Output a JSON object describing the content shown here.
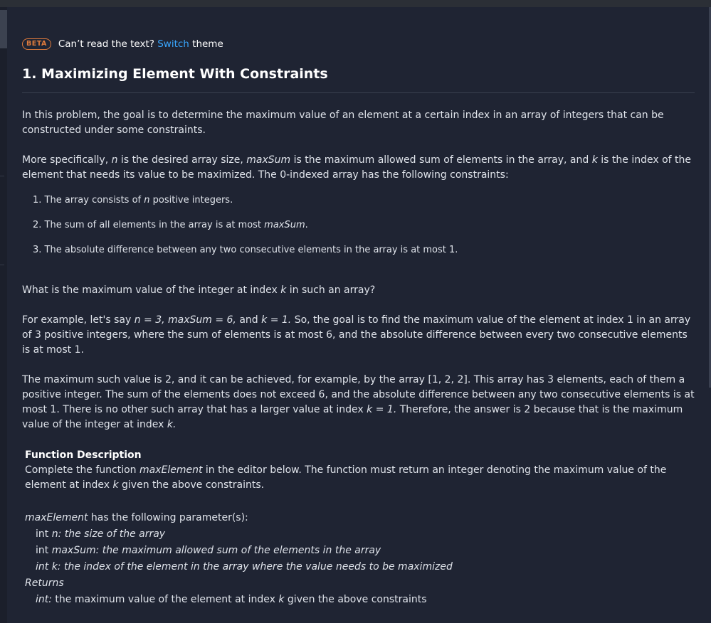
{
  "banner": {
    "badge": "BETA",
    "prefix": "Can’t read the text?",
    "link": "Switch",
    "suffix": "theme"
  },
  "problem": {
    "title": "1. Maximizing Element With Constraints",
    "intro": "In this problem, the goal is to determine the maximum value of an element at a certain index in an array of integers that can be constructed under some constraints.",
    "spec": {
      "t1": "More specifically, ",
      "n": "n",
      "t2": " is the desired array size, ",
      "maxSum": "maxSum",
      "t3": " is the maximum allowed sum of elements in the array, and ",
      "k": "k",
      "t4": " is the index of the element that needs its value to be maximized. The 0-indexed array has the following constraints:"
    },
    "constraints": [
      {
        "num": "1.",
        "pre": "The array consists of ",
        "em": "n",
        "post": " positive integers."
      },
      {
        "num": "2.",
        "pre": "The sum of all elements in the array is at most ",
        "em": "maxSum",
        "post": "."
      },
      {
        "num": "3.",
        "pre": "The absolute difference between any two consecutive elements in the array is at most 1.",
        "em": "",
        "post": ""
      }
    ],
    "question": {
      "pre": "What is the maximum value of the integer at index ",
      "k": "k",
      "post": " in such an array?"
    },
    "example": {
      "t1": "For example, let's say ",
      "e1": "n = 3, maxSum = 6,",
      "t2": " and ",
      "e2": "k = 1.",
      "t3": " So, the goal is to find the maximum value of the element at index 1 in an array of 3 positive integers, where the sum of elements is at most 6, and the absolute difference between every two consecutive elements is at most 1."
    },
    "explanation": {
      "t1": "The maximum such value is 2, and it can be achieved, for example, by the array [1, 2, 2]. This array has 3 elements, each of them a positive integer. The sum of the elements does not exceed 6, and the absolute difference between any two consecutive elements is at most 1. There is no other such array that has a larger value at index ",
      "e1": "k = 1.",
      "t2": " Therefore, the answer is 2 because that is the maximum value of the integer at index ",
      "e2": "k.",
      "t3": ""
    }
  },
  "function_description": {
    "heading": "Function Description",
    "t1": "Complete the function ",
    "fn": "maxElement",
    "t2": " in the editor below. The function must return an integer denoting the maximum value of the element at index ",
    "k": "k",
    "t3": " given the above constraints.",
    "params_fn": "maxElement",
    "params_intro": " has the following parameter(s):",
    "params": [
      {
        "type": "int ",
        "name": "n:",
        "desc": " the size of the array"
      },
      {
        "type": "int ",
        "name": "maxSum:",
        "desc": " the maximum allowed sum of the elements in the array"
      },
      {
        "type": "",
        "name": "int k:",
        "desc": " the index of the element in the array where the value needs to be maximized"
      }
    ],
    "returns_label": "Returns",
    "returns": {
      "type": "int:",
      "t1": " the maximum value of the element at index ",
      "k": "k",
      "t2": " given the above constraints"
    }
  },
  "colors": {
    "background": "#1f2433",
    "text": "#dfe3ea",
    "link": "#39a7ff",
    "badge": "#e07b3c"
  }
}
